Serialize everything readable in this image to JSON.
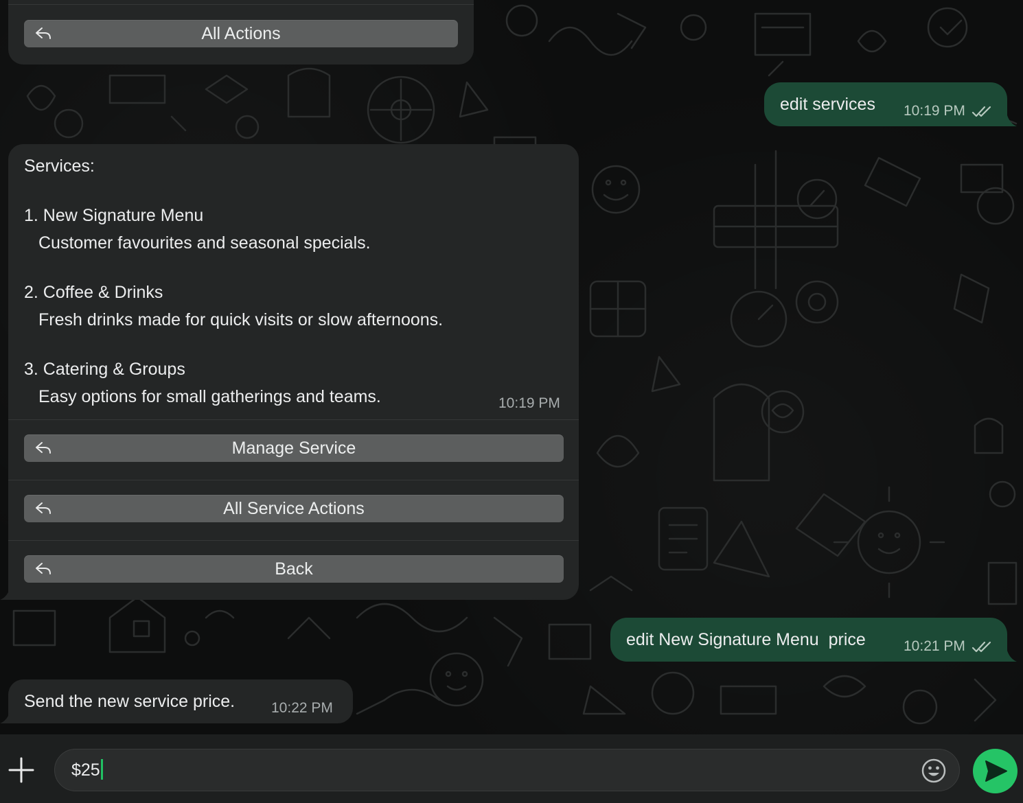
{
  "colors": {
    "incoming_bubble": "#242626",
    "outgoing_bubble": "#1c4a36",
    "action_button": "#5c5e5e",
    "send_button": "#25c466",
    "caret": "#21c063"
  },
  "messages": {
    "m0": {
      "actions": {
        "all_actions": "All Actions"
      }
    },
    "m1": {
      "text": "edit services",
      "time": "10:19 PM",
      "status_icon": "double-check-icon"
    },
    "m2": {
      "title": "Services:",
      "items": [
        {
          "name": "1. New Signature Menu",
          "desc": "Customer favourites and seasonal specials."
        },
        {
          "name": "2. Coffee & Drinks",
          "desc": "Fresh drinks made for quick visits or slow afternoons."
        },
        {
          "name": "3. Catering & Groups",
          "desc": "Easy options for small gatherings and teams."
        }
      ],
      "time": "10:19 PM",
      "actions": {
        "manage_service": "Manage Service",
        "all_service_actions": "All Service Actions",
        "back": "Back"
      }
    },
    "m3": {
      "text": "edit New Signature Menu  price",
      "time": "10:21 PM",
      "status_icon": "double-check-icon"
    },
    "m4": {
      "text": "Send the new service price.",
      "time": "10:22 PM"
    }
  },
  "composer": {
    "value": "$25",
    "attach_icon": "plus-icon",
    "emoji_icon": "smiley-icon",
    "send_icon": "send-icon"
  }
}
